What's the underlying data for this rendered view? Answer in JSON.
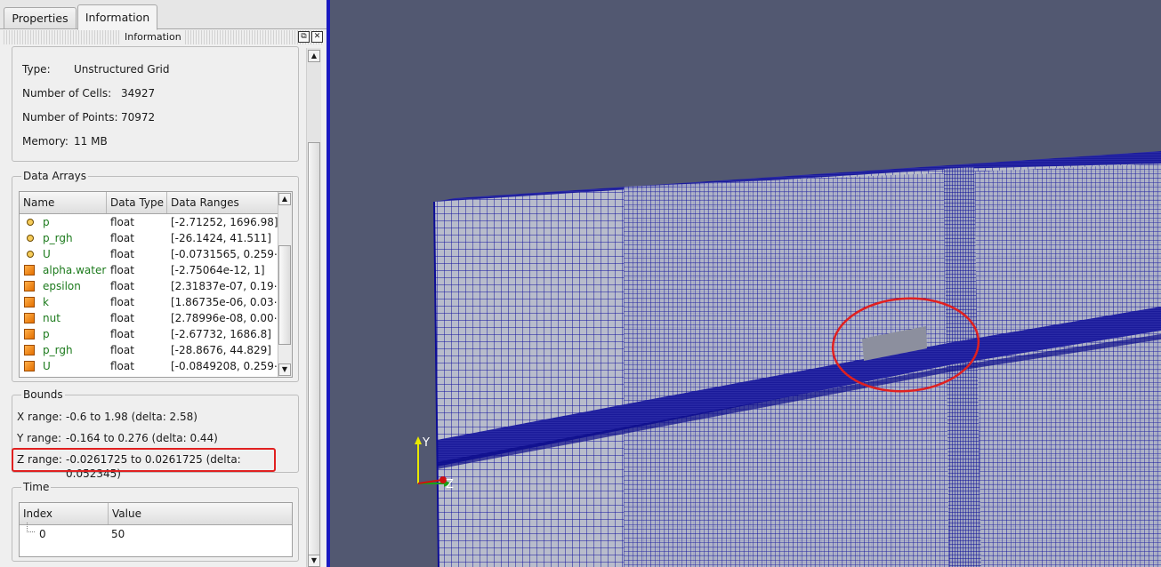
{
  "tabs": [
    {
      "label": "Properties"
    },
    {
      "label": "Information"
    }
  ],
  "dock": {
    "title": "Information"
  },
  "stats": {
    "type_label": "Type:",
    "type_value": "Unstructured Grid",
    "cells_label": "Number of Cells:",
    "cells_value": "34927",
    "points_label": "Number of Points:",
    "points_value": "70972",
    "memory_label": "Memory:",
    "memory_value": "11 MB"
  },
  "data_arrays": {
    "title": "Data Arrays",
    "headers": [
      "Name",
      "Data Type",
      "Data Ranges"
    ],
    "rows": [
      {
        "icon": "point-data-icon",
        "name": "p",
        "type": "float",
        "range": "[-2.71252, 1696.98]"
      },
      {
        "icon": "point-data-icon",
        "name": "p_rgh",
        "type": "float",
        "range": "[-26.1424, 41.511]"
      },
      {
        "icon": "point-data-icon",
        "name": "U",
        "type": "float",
        "range": "[-0.0731565, 0.259⋯"
      },
      {
        "icon": "cell-data-icon",
        "name": "alpha.water",
        "type": "float",
        "range": "[-2.75064e-12, 1]"
      },
      {
        "icon": "cell-data-icon",
        "name": "epsilon",
        "type": "float",
        "range": "[2.31837e-07, 0.19⋯"
      },
      {
        "icon": "cell-data-icon",
        "name": "k",
        "type": "float",
        "range": "[1.86735e-06, 0.03⋯"
      },
      {
        "icon": "cell-data-icon",
        "name": "nut",
        "type": "float",
        "range": "[2.78996e-08, 0.00⋯"
      },
      {
        "icon": "cell-data-icon",
        "name": "p",
        "type": "float",
        "range": "[-2.67732, 1686.8]"
      },
      {
        "icon": "cell-data-icon",
        "name": "p_rgh",
        "type": "float",
        "range": "[-28.8676, 44.829]"
      },
      {
        "icon": "cell-data-icon",
        "name": "U",
        "type": "float",
        "range": "[-0.0849208, 0.259⋯"
      }
    ]
  },
  "bounds": {
    "title": "Bounds",
    "x_label": "X range:",
    "x_value": "-0.6 to 1.98 (delta: 2.58)",
    "y_label": "Y range:",
    "y_value": "-0.164 to 0.276 (delta: 0.44)",
    "z_label": "Z range:",
    "z_value": "-0.0261725 to 0.0261725 (delta: 0.052345)"
  },
  "time": {
    "title": "Time",
    "headers": [
      "Index",
      "Value"
    ],
    "rows": [
      {
        "index": "0",
        "value": "50"
      }
    ]
  },
  "viewport": {
    "axis_y_label": "Y",
    "axis_z_label": "Z",
    "background_color": "#525871",
    "mesh_color": "#0c0c96",
    "highlight_color": "#e02020"
  }
}
